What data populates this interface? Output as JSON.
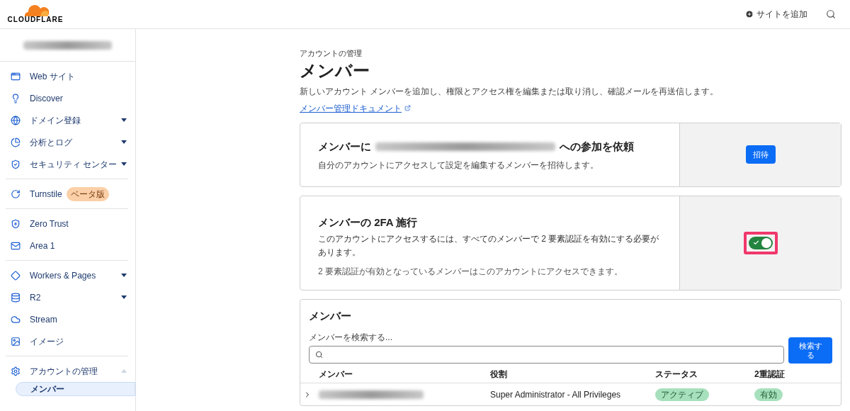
{
  "header": {
    "logo_text": "CLOUDFLARE",
    "add_site": "サイトを追加"
  },
  "sidebar": {
    "groups": [
      [
        {
          "label": "Web サイト",
          "selected": false
        },
        {
          "label": "Discover",
          "selected": false
        },
        {
          "label": "ドメイン登録",
          "expanded": false,
          "selected": false
        },
        {
          "label": "分析とログ",
          "expanded": false,
          "selected": false
        },
        {
          "label": "セキュリティ センター",
          "expanded": false,
          "selected": false
        }
      ],
      [
        {
          "label": "Turnstile",
          "badge": "ベータ版",
          "selected": false
        }
      ],
      [
        {
          "label": "Zero Trust",
          "selected": false
        },
        {
          "label": "Area 1",
          "selected": false
        }
      ],
      [
        {
          "label": "Workers & Pages",
          "expanded": false,
          "selected": false
        },
        {
          "label": "R2",
          "expanded": false,
          "selected": false
        },
        {
          "label": "Stream",
          "selected": false
        },
        {
          "label": "イメージ",
          "selected": false
        }
      ],
      [
        {
          "label": "アカウントの管理",
          "expanded": true,
          "selected": false,
          "children": [
            {
              "label": "メンバー",
              "selected": true
            }
          ]
        }
      ]
    ]
  },
  "page": {
    "breadcrumb": "アカウントの管理",
    "title": "メンバー",
    "description": "新しいアカウント メンバーを追加し、権限とアクセス権を編集または取り消し、確認メールを再送信します。",
    "doc_link": "メンバー管理ドキュメント"
  },
  "invite": {
    "title_prefix": "メンバーに",
    "title_suffix": "への参加を依頼",
    "description": "自分のアカウントにアクセスして設定を編集するメンバーを招待します。",
    "button": "招待"
  },
  "two_factor": {
    "title": "メンバーの 2FA 施行",
    "description": "このアカウントにアクセスするには、すべてのメンバーで 2 要素認証を有効にする必要があります。",
    "note": "2 要素認証が有効となっているメンバーはこのアカウントにアクセスできます。",
    "on": true
  },
  "members": {
    "title": "メンバー",
    "search_label": "メンバーを検索する...",
    "search_button": "検索する",
    "columns": [
      "メンバー",
      "役割",
      "ステータス",
      "2重認証"
    ],
    "rows": [
      {
        "expanded": false,
        "role": "Super Administrator - All Privileges",
        "status": "アクティブ",
        "two_factor": "有効"
      }
    ]
  }
}
